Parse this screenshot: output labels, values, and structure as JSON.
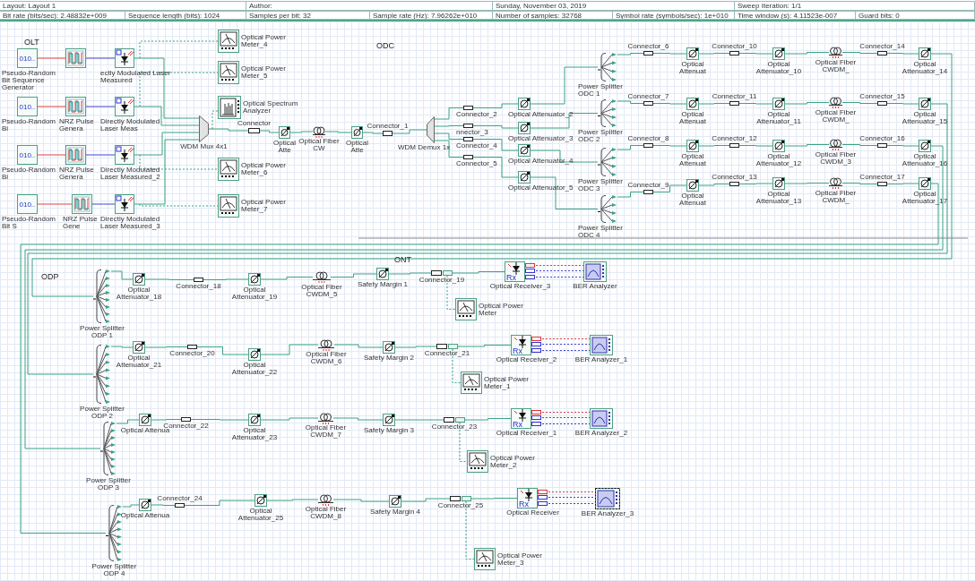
{
  "info_bar": {
    "layout_fields": [
      "Layout: Layout 1",
      "Author:",
      "Sunday, November 03, 2019",
      "Sweep Iteration: 1/1"
    ],
    "setting_fields": [
      "Bit rate (bits/sec):  2.48832e+009",
      "Sequence length (bits):  1024",
      "Samples per bit:  32",
      "Sample rate (Hz):  7.96262e+010",
      "Number of samples:  32768",
      "Symbol rate (symbols/sec):  1e+010",
      "Time window (s):  4.11523e-007",
      "Guard bits:  0"
    ]
  },
  "diagram": {
    "section_labels": [
      "OLT",
      "ODC",
      "ONT",
      "ODP"
    ],
    "components": [
      {
        "kind": "prbs",
        "label": "Pseudo-Random Bit Sequence Generator",
        "icon_text": "010..",
        "selected": false
      },
      {
        "kind": "nrz",
        "selected": false
      },
      {
        "kind": "laser",
        "label": "ectly Modulated Laser Measured",
        "selected": false
      },
      {
        "kind": "power_meter",
        "label": "Optical Power Meter_4",
        "selected": false
      },
      {
        "kind": "power_meter",
        "label": "Optical Power Meter_5",
        "selected": false
      },
      {
        "kind": "prbs",
        "label": "Pseudo-Random Bi",
        "icon_text": "010..",
        "selected": false
      },
      {
        "kind": "nrz",
        "label": "NRZ Pulse Genera",
        "selected": false
      },
      {
        "kind": "laser",
        "label": "Directly Modulated Laser Meas",
        "selected": false
      },
      {
        "kind": "spectrum_analyzer",
        "label": "Optical Spectrum Analyzer",
        "selected": false
      },
      {
        "kind": "mux",
        "label": "WDM Mux 4x1",
        "selected": false
      },
      {
        "kind": "connector",
        "label": "Connector",
        "selected": false
      },
      {
        "kind": "attenuator",
        "label": "Optical Atte",
        "selected": false
      },
      {
        "kind": "fiber",
        "label": "Optical Fiber CW",
        "selected": false
      },
      {
        "kind": "attenuator",
        "label": "Optical Atte",
        "selected": false
      },
      {
        "kind": "connector",
        "label": "Connector_1",
        "selected": false
      },
      {
        "kind": "demux",
        "label": "WDM Demux 1x",
        "selected": false
      },
      {
        "kind": "prbs",
        "label": "Pseudo-Random Bi",
        "icon_text": "010..",
        "selected": false
      },
      {
        "kind": "nrz",
        "label": "NRZ Pulse Genera",
        "selected": false
      },
      {
        "kind": "laser",
        "label": "Directly Modulated Laser Measured_2",
        "selected": false
      },
      {
        "kind": "power_meter",
        "label": "Optical Power Meter_6",
        "selected": false
      },
      {
        "kind": "prbs",
        "label": "Pseudo-Random Bit S",
        "icon_text": "010..",
        "selected": false
      },
      {
        "kind": "nrz",
        "label": "NRZ Pulse Gene",
        "selected": false
      },
      {
        "kind": "laser",
        "label": "Directly Modulated Laser Measured_3",
        "selected": false
      },
      {
        "kind": "power_meter",
        "label": "Optical Power Meter_7",
        "selected": false
      },
      {
        "kind": "connector",
        "label": "Connector_2",
        "selected": false
      },
      {
        "kind": "connector",
        "label": "nnector_3",
        "selected": false
      },
      {
        "kind": "connector",
        "label": "Connector_4",
        "selected": false
      },
      {
        "kind": "connector",
        "label": "Connector_5",
        "selected": false
      },
      {
        "kind": "attenuator",
        "label": "Optical Attenuator_2",
        "selected": false
      },
      {
        "kind": "attenuator",
        "label": "Optical Attenuator_3",
        "selected": false
      },
      {
        "kind": "attenuator",
        "label": "Optical Attenuator_4",
        "selected": false
      },
      {
        "kind": "attenuator",
        "label": "Optical Attenuator_5",
        "selected": false
      },
      {
        "kind": "splitter",
        "label": "Power Splitter ODC 1",
        "selected": false
      },
      {
        "kind": "connector",
        "label": "Connector_6",
        "selected": false
      },
      {
        "kind": "attenuator",
        "label": "Optical Attenuat",
        "selected": false
      },
      {
        "kind": "connector",
        "label": "Connector_10",
        "selected": false
      },
      {
        "kind": "attenuator",
        "label": "Optical Attenuator_10",
        "selected": false
      },
      {
        "kind": "fiber",
        "label": "Optical Fiber CWDM_",
        "selected": false
      },
      {
        "kind": "connector",
        "label": "Connector_14",
        "selected": false
      },
      {
        "kind": "attenuator",
        "label": "Optical Attenuator_14",
        "selected": false
      },
      {
        "kind": "splitter",
        "label": "Power Splitter ODC 2",
        "selected": false
      },
      {
        "kind": "connector",
        "label": "Connector_7",
        "selected": false
      },
      {
        "kind": "attenuator",
        "label": "Optical Attenuat",
        "selected": false
      },
      {
        "kind": "connector",
        "label": "Connector_11",
        "selected": false
      },
      {
        "kind": "attenuator",
        "label": "Optical Attenuator_11",
        "selected": false
      },
      {
        "kind": "fiber",
        "label": "Optical Fiber CWDM_",
        "selected": false
      },
      {
        "kind": "connector",
        "label": "Connector_15",
        "selected": false
      },
      {
        "kind": "attenuator",
        "label": "Optical Attenuator_15",
        "selected": false
      },
      {
        "kind": "splitter",
        "label": "Power Splitter ODC 3",
        "selected": false
      },
      {
        "kind": "connector",
        "label": "Connector_8",
        "selected": false
      },
      {
        "kind": "attenuator",
        "label": "Optical Attenuat",
        "selected": false
      },
      {
        "kind": "connector",
        "label": "Connector_12",
        "selected": false
      },
      {
        "kind": "attenuator",
        "label": "Optical Attenuator_12",
        "selected": false
      },
      {
        "kind": "fiber",
        "label": "Optical Fiber CWDM_3",
        "selected": false
      },
      {
        "kind": "connector",
        "label": "Connector_16",
        "selected": false
      },
      {
        "kind": "attenuator",
        "label": "Optical Attenuator_16",
        "selected": false
      },
      {
        "kind": "splitter",
        "label": "Power Splitter ODC 4",
        "selected": false
      },
      {
        "kind": "connector",
        "label": "Connector_9",
        "selected": false
      },
      {
        "kind": "attenuator",
        "label": "Optical Attenuat",
        "selected": false
      },
      {
        "kind": "connector",
        "label": "Connector_13",
        "selected": false
      },
      {
        "kind": "attenuator",
        "label": "Optical Attenuator_13",
        "selected": false
      },
      {
        "kind": "fiber",
        "label": "Optical Fiber CWDM_",
        "selected": false
      },
      {
        "kind": "connector",
        "label": "Connector_17",
        "selected": false
      },
      {
        "kind": "attenuator",
        "label": "Optical Attenuator_17",
        "selected": false
      },
      {
        "kind": "splitter",
        "label": "Power Splitter ODP 1",
        "selected": false
      },
      {
        "kind": "attenuator",
        "label": "Optical Attenuator_18",
        "selected": false
      },
      {
        "kind": "connector",
        "label": "Connector_18",
        "selected": false
      },
      {
        "kind": "attenuator",
        "label": "Optical Attenuator_19",
        "selected": false
      },
      {
        "kind": "fiber",
        "label": "Optical Fiber CWDM_5",
        "selected": false
      },
      {
        "kind": "attenuator",
        "label": "Safety Margin 1",
        "selected": false
      },
      {
        "kind": "tap",
        "label": "Connector_19",
        "selected": false
      },
      {
        "kind": "receiver",
        "label": "Optical Receiver_3",
        "icon_text": "Rx",
        "selected": false
      },
      {
        "kind": "ber_analyzer",
        "label": "BER Analyzer",
        "selected": false
      },
      {
        "kind": "power_meter",
        "label": "Optical Power Meter",
        "selected": false
      },
      {
        "kind": "splitter",
        "label": "Power Splitter ODP 2",
        "selected": false
      },
      {
        "kind": "attenuator",
        "label": "Optical Attenuator_21",
        "selected": false
      },
      {
        "kind": "connector",
        "label": "Connector_20",
        "selected": false
      },
      {
        "kind": "attenuator",
        "label": "Optical Attenuator_22",
        "selected": false
      },
      {
        "kind": "fiber",
        "label": "Optical Fiber CWDM_6",
        "selected": false
      },
      {
        "kind": "attenuator",
        "label": "Safety Margin 2",
        "selected": false
      },
      {
        "kind": "tap",
        "label": "Connector_21",
        "selected": false
      },
      {
        "kind": "receiver",
        "label": "Optical Receiver_2",
        "icon_text": "Rx",
        "selected": false
      },
      {
        "kind": "ber_analyzer",
        "label": "BER Analyzer_1",
        "selected": false
      },
      {
        "kind": "power_meter",
        "label": "Optical Power Meter_1",
        "selected": false
      },
      {
        "kind": "splitter",
        "label": "Power Splitter ODP 3",
        "selected": false
      },
      {
        "kind": "attenuator",
        "label": "Optical Attenua",
        "selected": false
      },
      {
        "kind": "connector",
        "label": "Connector_22",
        "selected": false
      },
      {
        "kind": "attenuator",
        "label": "Optical Attenuator_23",
        "selected": false
      },
      {
        "kind": "fiber",
        "label": "Optical Fiber CWDM_7",
        "selected": false
      },
      {
        "kind": "attenuator",
        "label": "Safety Margin 3",
        "selected": false
      },
      {
        "kind": "tap",
        "label": "Connector_23",
        "selected": false
      },
      {
        "kind": "receiver",
        "label": "Optical Receiver_1",
        "icon_text": "Rx",
        "selected": false
      },
      {
        "kind": "ber_analyzer",
        "label": "BER Analyzer_2",
        "selected": false
      },
      {
        "kind": "power_meter",
        "label": "Optical Power Meter_2",
        "selected": false
      },
      {
        "kind": "splitter",
        "label": "Power Splitter ODP 4",
        "selected": false
      },
      {
        "kind": "attenuator",
        "label": "Optical Attenua",
        "selected": false
      },
      {
        "kind": "connector",
        "label": "Connector_24",
        "selected": false
      },
      {
        "kind": "attenuator",
        "label": "Optical Attenuator_25",
        "selected": false
      },
      {
        "kind": "fiber",
        "label": "Optical Fiber CWDM_8",
        "selected": false
      },
      {
        "kind": "attenuator",
        "label": "Safety Margin 4",
        "selected": false
      },
      {
        "kind": "tap",
        "label": "Connector_25",
        "selected": false
      },
      {
        "kind": "receiver",
        "label": "Optical Receiver",
        "icon_text": "Rx",
        "selected": false
      },
      {
        "kind": "ber_analyzer",
        "label": "BER Analyzer_3",
        "selected": true
      },
      {
        "kind": "power_meter",
        "label": "Optical Power Meter_3",
        "selected": false
      }
    ]
  }
}
